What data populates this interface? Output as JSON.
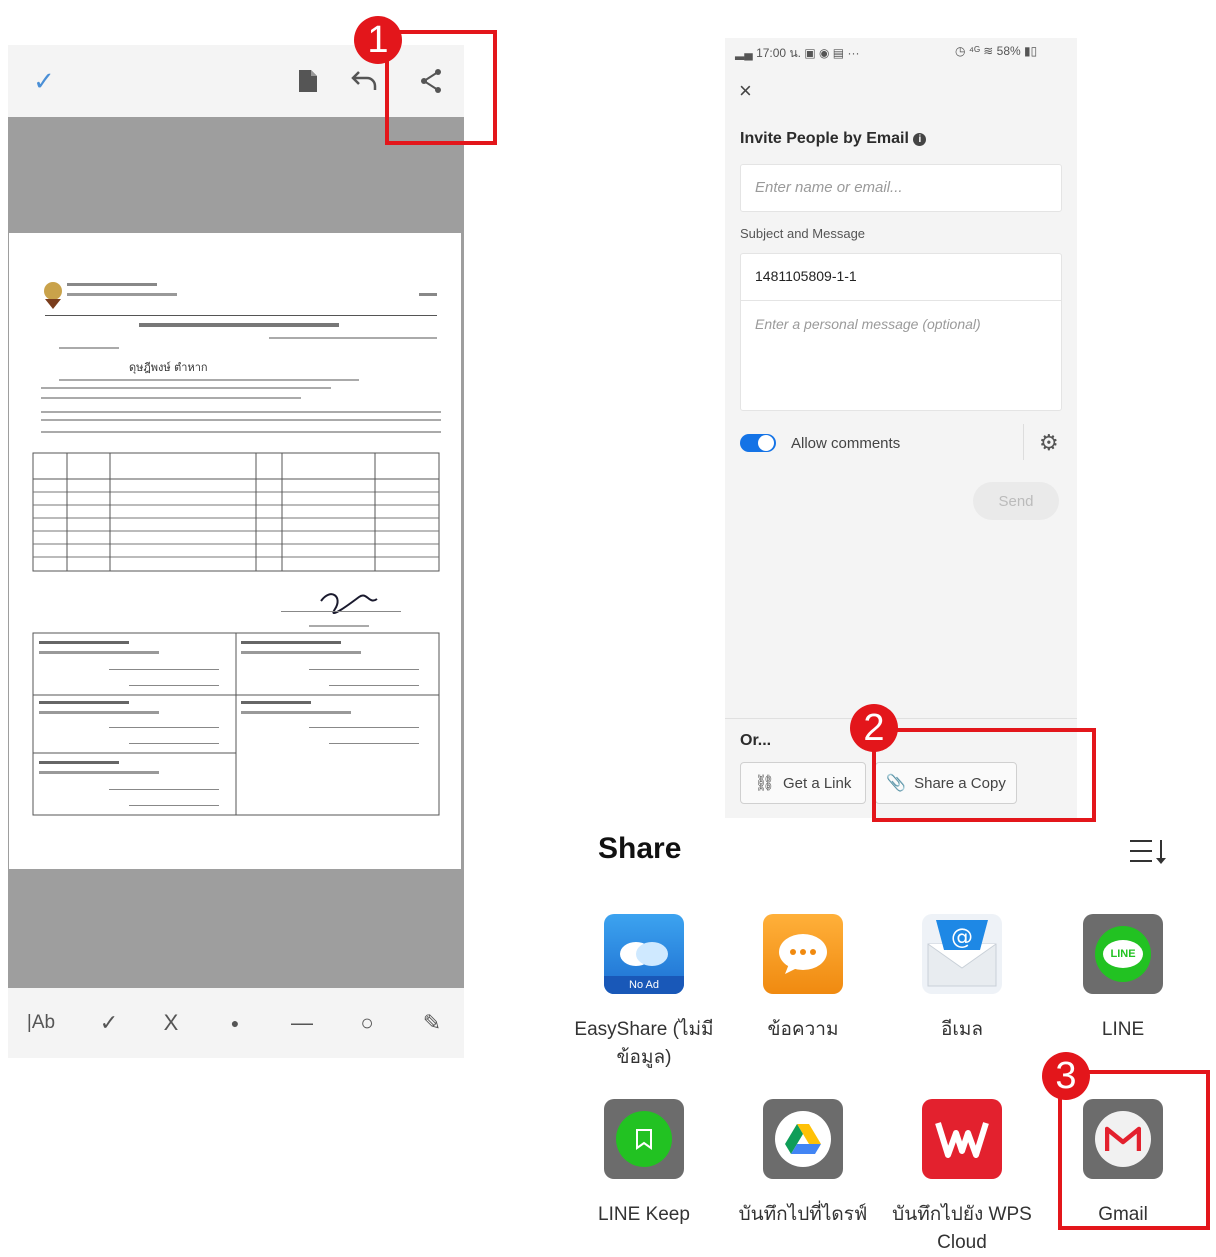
{
  "editor": {
    "toolbar_bottom": [
      "|Ab",
      "✓",
      "X",
      "●",
      "—",
      "○",
      "✎"
    ]
  },
  "invite": {
    "status_time": "17:00 น.",
    "status_battery": "58%",
    "title": "Invite People by Email",
    "email_placeholder": "Enter name or email...",
    "subject_label": "Subject and Message",
    "subject_value": "1481105809-1-1",
    "message_placeholder": "Enter a personal message (optional)",
    "allow_comments_label": "Allow comments",
    "send_label": "Send",
    "or_label": "Or...",
    "get_link_label": "Get a Link",
    "share_copy_label": "Share a Copy"
  },
  "share": {
    "title": "Share",
    "apps": [
      {
        "label": "EasyShare (ไม่มี ข้อมูล)",
        "icon": "easyshare-icon",
        "badge": "No Ad"
      },
      {
        "label": "ข้อความ",
        "icon": "message-icon"
      },
      {
        "label": "อีเมล",
        "icon": "email-icon"
      },
      {
        "label": "LINE",
        "icon": "line-icon",
        "badge": "LINE"
      },
      {
        "label": "LINE Keep",
        "icon": "line-keep-icon"
      },
      {
        "label": "บันทึกไปที่ไดรฟ์",
        "icon": "google-drive-icon"
      },
      {
        "label": "บันทึกไปยัง WPS Cloud",
        "icon": "wps-cloud-icon"
      },
      {
        "label": "Gmail",
        "icon": "gmail-icon"
      }
    ]
  },
  "annotations": {
    "step1": "1",
    "step2": "2",
    "step3": "3"
  },
  "colors": {
    "annotation_red": "#e3161b",
    "toggle_blue": "#1473e6",
    "checkmark_blue": "#4a8fd6"
  }
}
